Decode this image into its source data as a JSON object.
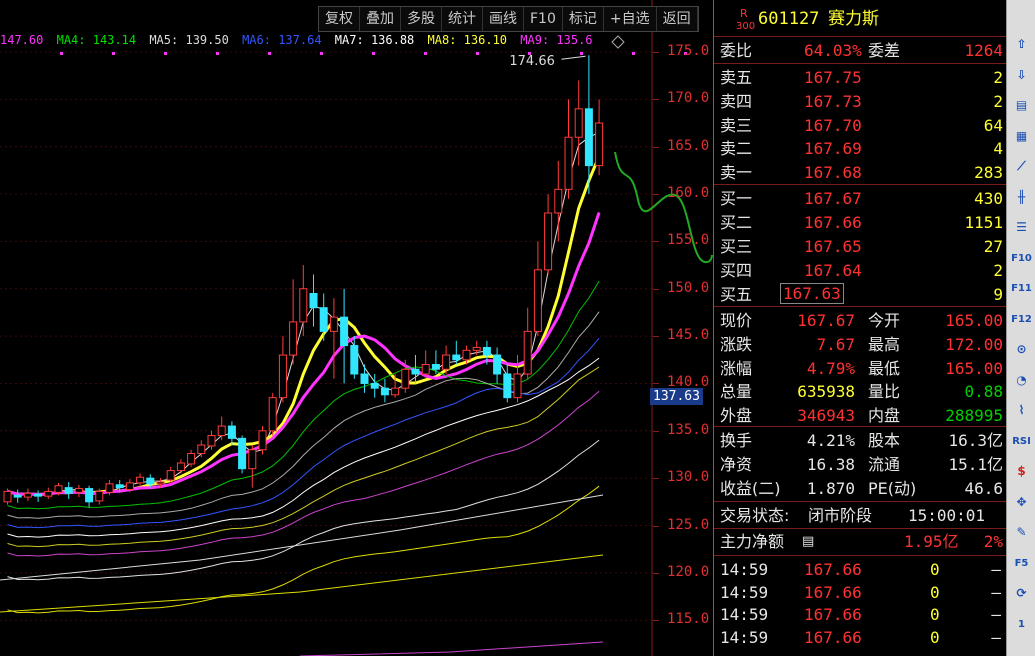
{
  "toolbar": {
    "items": [
      "复权",
      "叠加",
      "多股",
      "统计",
      "画线",
      "F10",
      "标记",
      "+自选",
      "返回"
    ]
  },
  "ma_legend": [
    {
      "label": "",
      "value": "147.60",
      "color": "#ff33ff"
    },
    {
      "label": "MA4:",
      "value": "143.14",
      "color": "#00e000"
    },
    {
      "label": "MA5:",
      "value": "139.50",
      "color": "#dcdcdc"
    },
    {
      "label": "MA6:",
      "value": "137.64",
      "color": "#3355ff"
    },
    {
      "label": "MA7:",
      "value": "136.88",
      "color": "#ffffff"
    },
    {
      "label": "MA8:",
      "value": "136.10",
      "color": "#ffff33"
    },
    {
      "label": "MA9:",
      "value": "135.6",
      "color": "#ff33ff"
    }
  ],
  "chart": {
    "y_ticks": [
      "175.0",
      "170.0",
      "165.0",
      "160.0",
      "155.0",
      "150.0",
      "145.0",
      "140.0",
      "135.0",
      "130.0",
      "125.0",
      "120.0",
      "115.0"
    ],
    "high_marker": "174.66",
    "current_tag": "137.63",
    "candles": [
      [
        127.5,
        128.6,
        127.2,
        128.9
      ],
      [
        128.2,
        128.0,
        127.4,
        128.8
      ],
      [
        128.0,
        128.4,
        127.6,
        128.9
      ],
      [
        128.3,
        128.1,
        127.5,
        128.7
      ],
      [
        128.1,
        128.6,
        127.8,
        129.0
      ],
      [
        128.5,
        129.2,
        128.2,
        129.5
      ],
      [
        129.0,
        128.4,
        127.8,
        129.6
      ],
      [
        128.5,
        128.9,
        128.0,
        129.3
      ],
      [
        128.9,
        127.5,
        126.9,
        129.2
      ],
      [
        127.6,
        128.6,
        127.2,
        128.9
      ],
      [
        128.5,
        129.4,
        128.2,
        129.8
      ],
      [
        129.3,
        129.0,
        128.6,
        129.8
      ],
      [
        128.8,
        129.5,
        128.5,
        129.9
      ],
      [
        129.5,
        130.1,
        129.2,
        130.5
      ],
      [
        130.0,
        129.4,
        129.0,
        130.4
      ],
      [
        129.4,
        129.6,
        129.0,
        130.0
      ],
      [
        129.8,
        130.8,
        129.5,
        131.2
      ],
      [
        130.8,
        131.6,
        130.5,
        132.0
      ],
      [
        131.5,
        132.6,
        131.2,
        133.0
      ],
      [
        132.6,
        133.5,
        132.2,
        134.0
      ],
      [
        133.4,
        134.5,
        133.0,
        135.0
      ],
      [
        134.5,
        135.5,
        134.0,
        136.5
      ],
      [
        135.5,
        134.2,
        133.5,
        136.0
      ],
      [
        134.2,
        131.0,
        130.5,
        134.5
      ],
      [
        131.0,
        133.0,
        129.0,
        133.5
      ],
      [
        133.0,
        135.0,
        132.5,
        135.5
      ],
      [
        135.0,
        138.5,
        134.5,
        139.0
      ],
      [
        138.5,
        143.0,
        138.0,
        145.0
      ],
      [
        143.0,
        146.5,
        142.0,
        151.0
      ],
      [
        146.5,
        150.0,
        145.0,
        152.5
      ],
      [
        149.5,
        148.0,
        146.0,
        151.5
      ],
      [
        148.0,
        145.5,
        144.5,
        149.5
      ],
      [
        145.5,
        147.0,
        140.5,
        149.0
      ],
      [
        147.0,
        144.0,
        140.0,
        150.0
      ],
      [
        144.0,
        141.0,
        140.5,
        145.0
      ],
      [
        141.0,
        140.0,
        139.0,
        142.0
      ],
      [
        140.0,
        139.5,
        138.5,
        141.0
      ],
      [
        139.5,
        138.8,
        138.0,
        140.5
      ],
      [
        138.8,
        139.5,
        138.5,
        141.0
      ],
      [
        139.5,
        141.5,
        139.0,
        142.5
      ],
      [
        141.5,
        141.0,
        140.0,
        143.0
      ],
      [
        141.0,
        142.0,
        140.5,
        143.5
      ],
      [
        142.0,
        141.5,
        141.0,
        143.5
      ],
      [
        141.5,
        143.0,
        141.0,
        144.0
      ],
      [
        143.0,
        142.5,
        142.0,
        144.5
      ],
      [
        142.5,
        143.5,
        142.0,
        144.0
      ],
      [
        143.5,
        143.8,
        143.0,
        144.5
      ],
      [
        143.8,
        143.0,
        142.0,
        144.5
      ],
      [
        143.0,
        141.0,
        140.0,
        143.8
      ],
      [
        141.0,
        138.5,
        138.0,
        142.0
      ],
      [
        138.5,
        141.0,
        138.0,
        143.0
      ],
      [
        141.0,
        145.5,
        140.5,
        148.0
      ],
      [
        145.5,
        152.0,
        145.0,
        155.0
      ],
      [
        152.0,
        158.0,
        151.5,
        160.0
      ],
      [
        158.0,
        160.5,
        155.0,
        163.5
      ],
      [
        160.5,
        166.0,
        159.5,
        170.0
      ],
      [
        166.0,
        169.0,
        163.0,
        172.0
      ],
      [
        169.0,
        163.0,
        160.0,
        174.66
      ],
      [
        163.0,
        167.5,
        162.0,
        170.0
      ]
    ]
  },
  "quote": {
    "code": "601127",
    "name": "赛力斯",
    "badge_top": "R",
    "badge_bottom": "300",
    "wei_bi_label": "委比",
    "wei_bi": "64.03%",
    "wei_cha_label": "委差",
    "wei_cha": "1264",
    "sell": [
      {
        "label": "卖五",
        "price": "167.75",
        "vol": "2"
      },
      {
        "label": "卖四",
        "price": "167.73",
        "vol": "2"
      },
      {
        "label": "卖三",
        "price": "167.70",
        "vol": "64"
      },
      {
        "label": "卖二",
        "price": "167.69",
        "vol": "4"
      },
      {
        "label": "卖一",
        "price": "167.68",
        "vol": "283"
      }
    ],
    "buy": [
      {
        "label": "买一",
        "price": "167.67",
        "vol": "430"
      },
      {
        "label": "买二",
        "price": "167.66",
        "vol": "1151"
      },
      {
        "label": "买三",
        "price": "167.65",
        "vol": "27"
      },
      {
        "label": "买四",
        "price": "167.64",
        "vol": "2"
      },
      {
        "label": "买五",
        "price": "167.63",
        "vol": "9"
      }
    ],
    "stats": [
      {
        "l1": "现价",
        "v1": "167.67",
        "c1": "red",
        "l2": "今开",
        "v2": "165.00",
        "c2": "red"
      },
      {
        "l1": "涨跌",
        "v1": "7.67",
        "c1": "red",
        "l2": "最高",
        "v2": "172.00",
        "c2": "red"
      },
      {
        "l1": "涨幅",
        "v1": "4.79%",
        "c1": "red",
        "l2": "最低",
        "v2": "165.00",
        "c2": "red"
      },
      {
        "l1": "总量",
        "v1": "635938",
        "c1": "yellow",
        "l2": "量比",
        "v2": "0.88",
        "c2": "green"
      },
      {
        "l1": "外盘",
        "v1": "346943",
        "c1": "red",
        "l2": "内盘",
        "v2": "288995",
        "c2": "green"
      }
    ],
    "fund": [
      {
        "l1": "换手",
        "v1": "4.21%",
        "l2": "股本",
        "v2": "16.3亿"
      },
      {
        "l1": "净资",
        "v1": "16.38",
        "l2": "流通",
        "v2": "15.1亿"
      },
      {
        "l1": "收益(二)",
        "v1": "1.870",
        "l2": "PE(动)",
        "v2": "46.6"
      }
    ],
    "status_label": "交易状态:",
    "status_value": "闭市阶段",
    "status_time": "15:00:01",
    "main_flow_label": "主力净额",
    "main_flow_value": "1.95亿",
    "main_flow_pct": "2%",
    "ticks": [
      {
        "time": "14:59",
        "price": "167.66",
        "vol": "0",
        "flag": "—"
      },
      {
        "time": "14:59",
        "price": "167.66",
        "vol": "0",
        "flag": "—"
      },
      {
        "time": "14:59",
        "price": "167.66",
        "vol": "0",
        "flag": "—"
      },
      {
        "time": "14:59",
        "price": "167.66",
        "vol": "0",
        "flag": "—"
      }
    ]
  },
  "sidebar": {
    "icons": [
      "arrow-up-icon",
      "arrow-down-icon",
      "report-icon",
      "table-icon",
      "line-chart-icon",
      "candlestick-icon",
      "list-icon",
      "f10-icon",
      "f11-icon",
      "f12-icon",
      "indicator-icon",
      "analysis-icon",
      "chart-icon",
      "rsi-icon",
      "dollar-icon",
      "move-icon",
      "pencil-icon",
      "f5-icon",
      "refresh-icon",
      "page-number"
    ],
    "labels": {
      "f10": "F10",
      "f11": "F11",
      "f12": "F12",
      "rsi": "RSI",
      "f5": "F5",
      "page": "1"
    }
  }
}
